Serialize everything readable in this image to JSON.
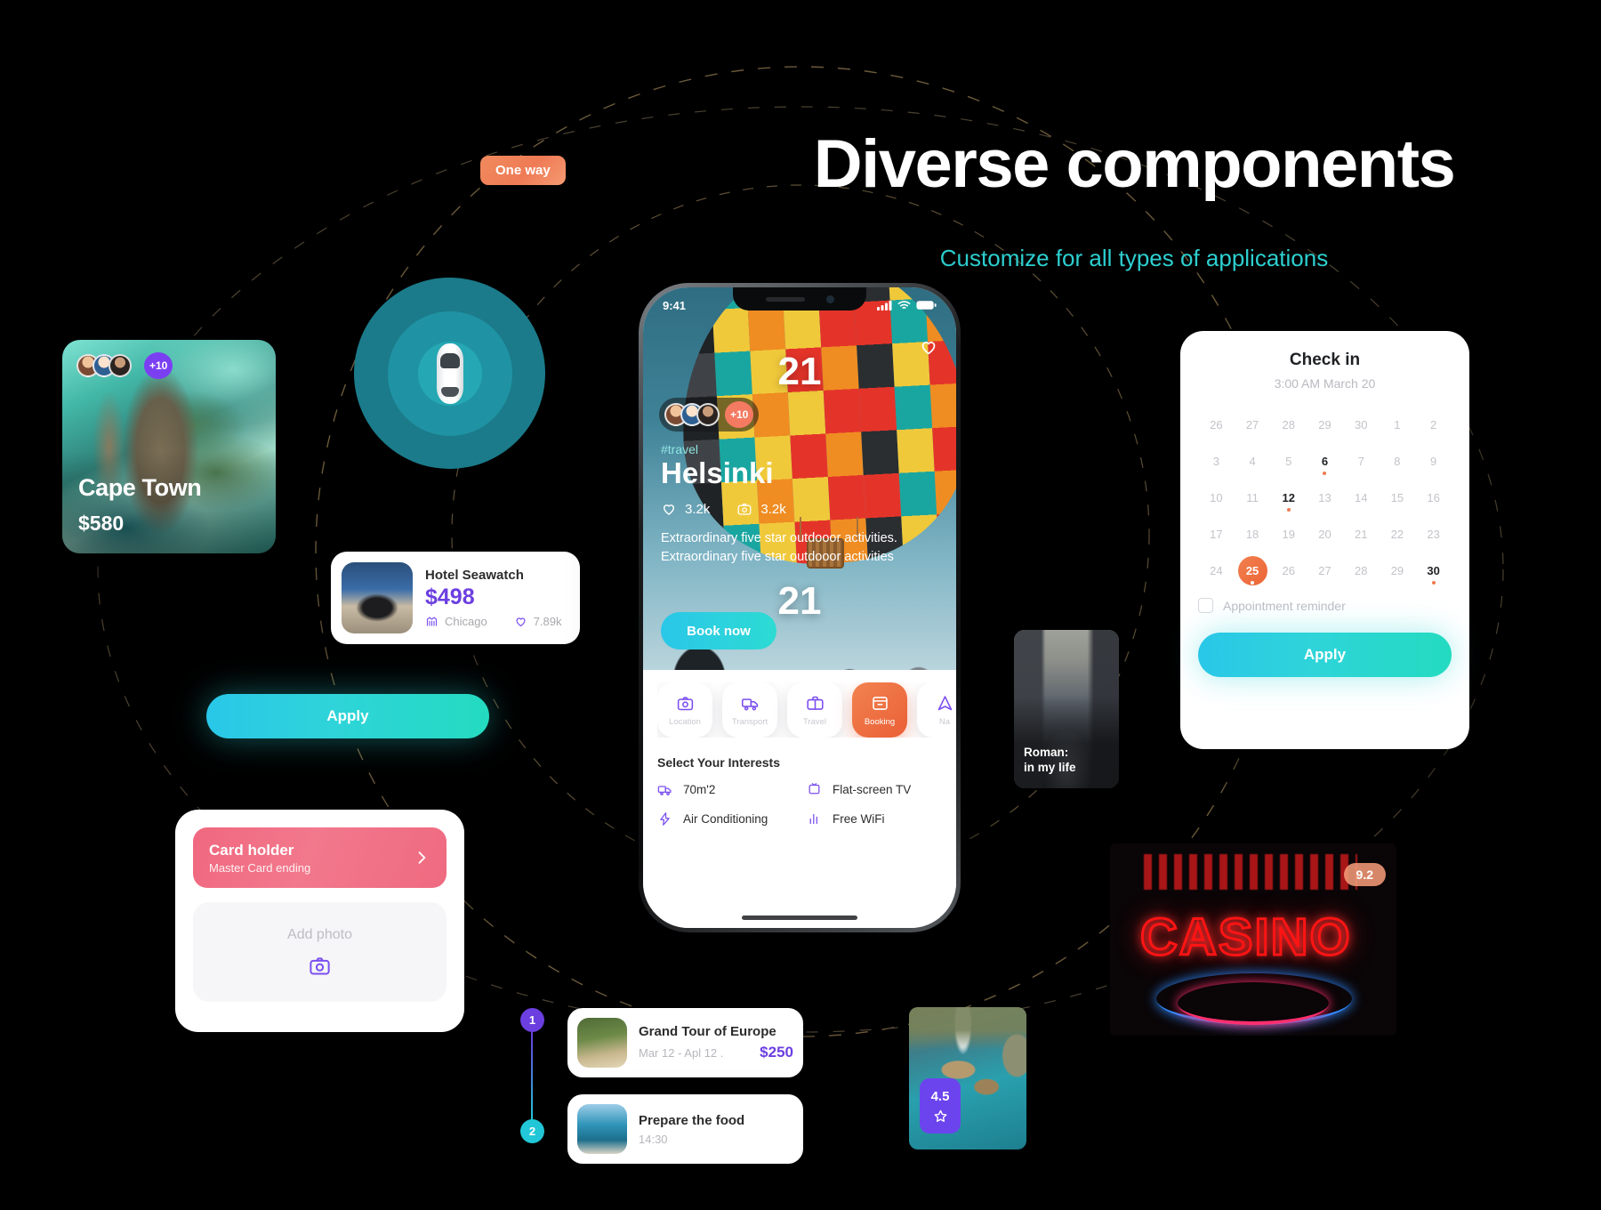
{
  "hero": {
    "title": "Diverse components",
    "subtitle": "Customize for all types of applications"
  },
  "one_way_badge": {
    "label": "One way"
  },
  "cape_town_card": {
    "city": "Cape Town",
    "price": "$580",
    "extra_avatars": "+10"
  },
  "car_radar": {
    "name": "car-radar"
  },
  "hotel_card": {
    "name": "Hotel Seawatch",
    "price": "$498",
    "city": "Chicago",
    "likes": "7.89k"
  },
  "apply_button_left": {
    "label": "Apply"
  },
  "payment_card": {
    "card_holder_title": "Card holder",
    "card_holder_sub": "Master Card ending",
    "add_photo_label": "Add photo"
  },
  "calendar_card": {
    "title": "Check in",
    "subtitle": "3:00 AM March 20",
    "weeks": [
      [
        {
          "d": "26"
        },
        {
          "d": "27"
        },
        {
          "d": "28"
        },
        {
          "d": "29"
        },
        {
          "d": "30"
        },
        {
          "d": "1"
        },
        {
          "d": "2"
        }
      ],
      [
        {
          "d": "3"
        },
        {
          "d": "4"
        },
        {
          "d": "5"
        },
        {
          "d": "6",
          "bold": true,
          "dot": true
        },
        {
          "d": "7"
        },
        {
          "d": "8"
        },
        {
          "d": "9"
        }
      ],
      [
        {
          "d": "10"
        },
        {
          "d": "11"
        },
        {
          "d": "12",
          "bold": true,
          "dot": true
        },
        {
          "d": "13"
        },
        {
          "d": "14"
        },
        {
          "d": "15"
        },
        {
          "d": "16"
        }
      ],
      [
        {
          "d": "17"
        },
        {
          "d": "18"
        },
        {
          "d": "19"
        },
        {
          "d": "20"
        },
        {
          "d": "21"
        },
        {
          "d": "22"
        },
        {
          "d": "23"
        }
      ],
      [
        {
          "d": "24"
        },
        {
          "d": "25",
          "selected": true,
          "dot": true
        },
        {
          "d": "26"
        },
        {
          "d": "27"
        },
        {
          "d": "28"
        },
        {
          "d": "29"
        },
        {
          "d": "30",
          "bold": true,
          "dot": true
        }
      ]
    ],
    "reminder_label": "Appointment reminder",
    "apply_label": "Apply"
  },
  "phone": {
    "status": {
      "time": "9:41"
    },
    "hero": {
      "overlay_number_top": "21",
      "overlay_number_bottom": "21",
      "extra_avatars": "+10",
      "tag": "#travel",
      "city": "Helsinki",
      "likes": "3.2k",
      "photos": "3.2k",
      "description": "Extraordinary five star outdooor activities. Extraordinary five star outdooor activities",
      "book_label": "Book now"
    },
    "tabs": [
      {
        "label": "Location",
        "icon": "camera-icon",
        "active": false
      },
      {
        "label": "Transport",
        "icon": "truck-icon",
        "active": false
      },
      {
        "label": "Travel",
        "icon": "briefcase-icon",
        "active": false
      },
      {
        "label": "Booking",
        "icon": "archive-icon",
        "active": true
      },
      {
        "label": "Na",
        "icon": "navigation-icon",
        "active": false
      }
    ],
    "interests_title": "Select Your Interests",
    "amenities": [
      {
        "label": "70m'2",
        "icon": "truck-icon"
      },
      {
        "label": "Flat-screen TV",
        "icon": "tv-icon"
      },
      {
        "label": "Air Conditioning",
        "icon": "bolt-icon"
      },
      {
        "label": "Free WiFi",
        "icon": "bars-icon"
      }
    ]
  },
  "roman_card": {
    "line1": "Roman:",
    "line2": "in my life"
  },
  "casino_card": {
    "sign_text": "CASINO",
    "rating": "9.2"
  },
  "waterfall_card": {
    "rating": "4.5"
  },
  "timeline": {
    "nodes": [
      "1",
      "2"
    ],
    "items": [
      {
        "title": "Grand Tour of Europe",
        "date": "Mar 12 - Apl 12 .",
        "price": "$250"
      },
      {
        "title": "Prepare the food",
        "time": "14:30"
      }
    ]
  },
  "colors": {
    "background": "#000000",
    "accent_cyan": "#2ecfd0",
    "accent_purple": "#6c3fe0",
    "accent_orange": "#ef7a50",
    "accent_pink": "#f0687f"
  }
}
